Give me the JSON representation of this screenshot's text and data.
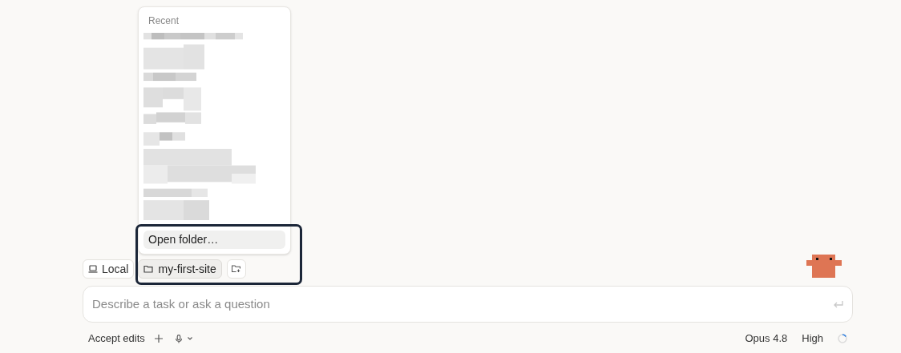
{
  "recent_menu": {
    "heading": "Recent",
    "action": {
      "label": "Open folder…",
      "highlighted": true
    }
  },
  "location_bar": {
    "environment": "Local",
    "folder": {
      "label": "my-first-site",
      "selected": true
    }
  },
  "prompt": {
    "placeholder": "Describe a task or ask a question"
  },
  "footer": {
    "mode": "Accept edits",
    "model": "Opus 4.8",
    "effort": "High"
  }
}
